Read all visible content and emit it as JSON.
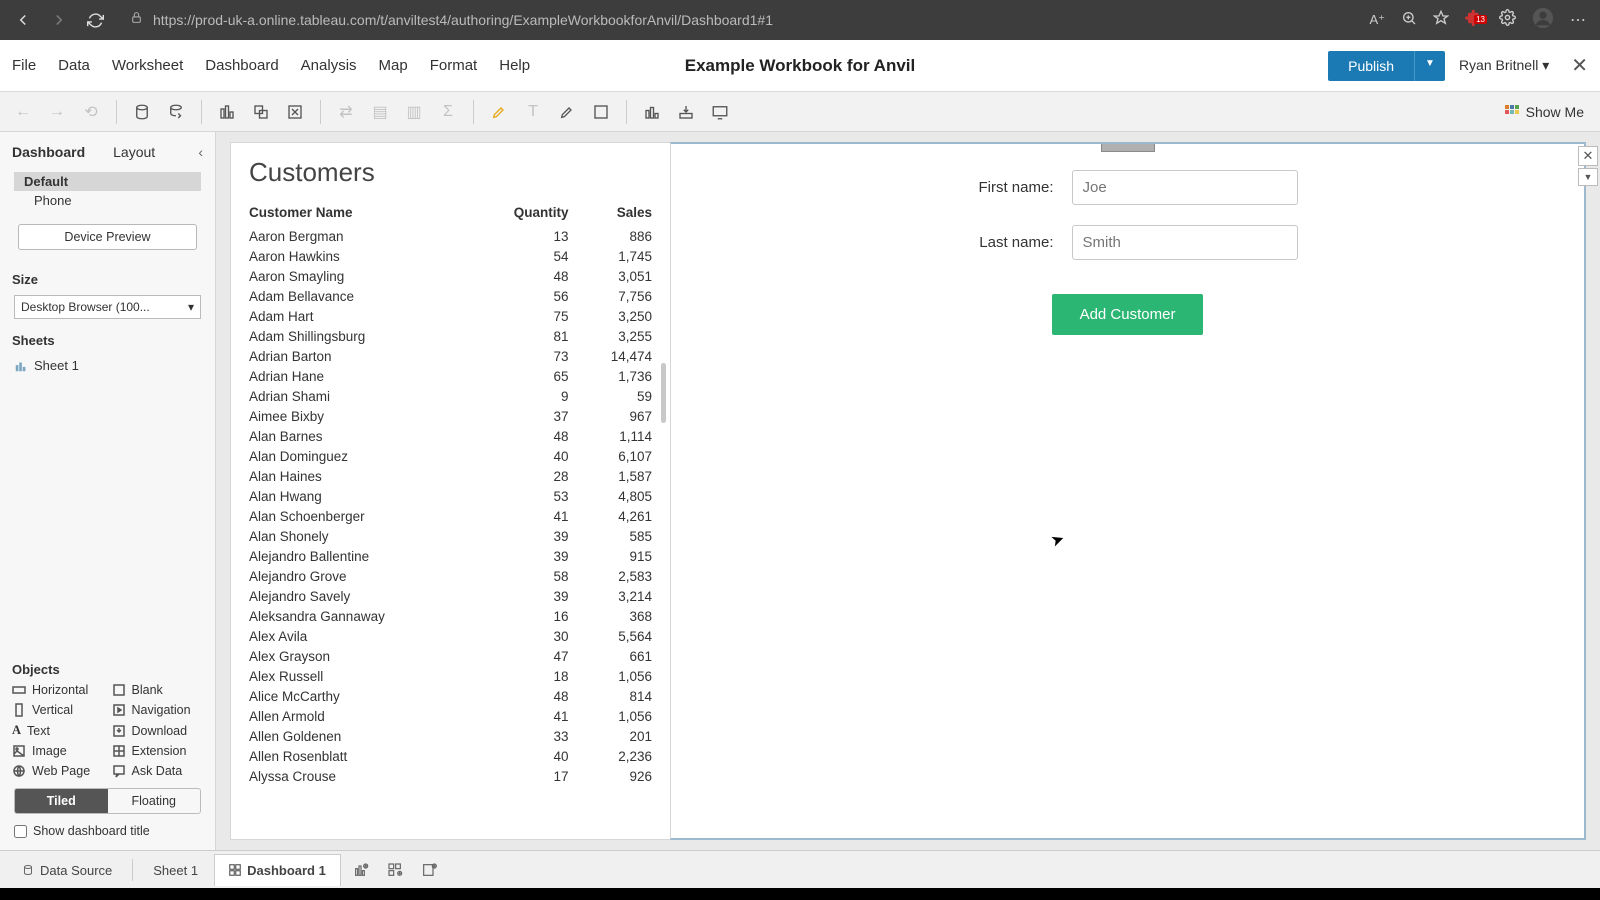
{
  "browser": {
    "url": "https://prod-uk-a.online.tableau.com/t/anviltest4/authoring/ExampleWorkbookforAnvil/Dashboard1#1",
    "extension_count": "13"
  },
  "app": {
    "menu": [
      "File",
      "Data",
      "Worksheet",
      "Dashboard",
      "Analysis",
      "Map",
      "Format",
      "Help"
    ],
    "title": "Example Workbook for Anvil",
    "publish": "Publish",
    "user": "Ryan Britnell ▾"
  },
  "toolbar": {
    "show_me": "Show Me"
  },
  "sidebar": {
    "tab_dashboard": "Dashboard",
    "tab_layout": "Layout",
    "devices": {
      "default": "Default",
      "phone": "Phone"
    },
    "device_preview": "Device Preview",
    "size_label": "Size",
    "size_value": "Desktop Browser (100...",
    "sheets_label": "Sheets",
    "sheet1": "Sheet 1",
    "objects_label": "Objects",
    "objects": {
      "horizontal": "Horizontal",
      "blank": "Blank",
      "vertical": "Vertical",
      "navigation": "Navigation",
      "text": "Text",
      "download": "Download",
      "image": "Image",
      "extension": "Extension",
      "webpage": "Web Page",
      "askdata": "Ask Data"
    },
    "tiled": "Tiled",
    "floating": "Floating",
    "show_title": "Show dashboard title"
  },
  "sheet": {
    "title": "Customers",
    "cols": {
      "name": "Customer Name",
      "qty": "Quantity",
      "sales": "Sales"
    },
    "rows": [
      {
        "n": "Aaron Bergman",
        "q": "13",
        "s": "886"
      },
      {
        "n": "Aaron Hawkins",
        "q": "54",
        "s": "1,745"
      },
      {
        "n": "Aaron Smayling",
        "q": "48",
        "s": "3,051"
      },
      {
        "n": "Adam Bellavance",
        "q": "56",
        "s": "7,756"
      },
      {
        "n": "Adam Hart",
        "q": "75",
        "s": "3,250"
      },
      {
        "n": "Adam Shillingsburg",
        "q": "81",
        "s": "3,255"
      },
      {
        "n": "Adrian Barton",
        "q": "73",
        "s": "14,474"
      },
      {
        "n": "Adrian Hane",
        "q": "65",
        "s": "1,736"
      },
      {
        "n": "Adrian Shami",
        "q": "9",
        "s": "59"
      },
      {
        "n": "Aimee Bixby",
        "q": "37",
        "s": "967"
      },
      {
        "n": "Alan Barnes",
        "q": "48",
        "s": "1,114"
      },
      {
        "n": "Alan Dominguez",
        "q": "40",
        "s": "6,107"
      },
      {
        "n": "Alan Haines",
        "q": "28",
        "s": "1,587"
      },
      {
        "n": "Alan Hwang",
        "q": "53",
        "s": "4,805"
      },
      {
        "n": "Alan Schoenberger",
        "q": "41",
        "s": "4,261"
      },
      {
        "n": "Alan Shonely",
        "q": "39",
        "s": "585"
      },
      {
        "n": "Alejandro Ballentine",
        "q": "39",
        "s": "915"
      },
      {
        "n": "Alejandro Grove",
        "q": "58",
        "s": "2,583"
      },
      {
        "n": "Alejandro Savely",
        "q": "39",
        "s": "3,214"
      },
      {
        "n": "Aleksandra Gannaway",
        "q": "16",
        "s": "368"
      },
      {
        "n": "Alex Avila",
        "q": "30",
        "s": "5,564"
      },
      {
        "n": "Alex Grayson",
        "q": "47",
        "s": "661"
      },
      {
        "n": "Alex Russell",
        "q": "18",
        "s": "1,056"
      },
      {
        "n": "Alice McCarthy",
        "q": "48",
        "s": "814"
      },
      {
        "n": "Allen Armold",
        "q": "41",
        "s": "1,056"
      },
      {
        "n": "Allen Goldenen",
        "q": "33",
        "s": "201"
      },
      {
        "n": "Allen Rosenblatt",
        "q": "40",
        "s": "2,236"
      },
      {
        "n": "Alyssa Crouse",
        "q": "17",
        "s": "926"
      }
    ]
  },
  "form": {
    "first_label": "First name:",
    "first_ph": "Joe",
    "last_label": "Last name:",
    "last_ph": "Smith",
    "button": "Add Customer"
  },
  "bottom": {
    "datasource": "Data Source",
    "sheet1": "Sheet 1",
    "dashboard1": "Dashboard 1"
  }
}
